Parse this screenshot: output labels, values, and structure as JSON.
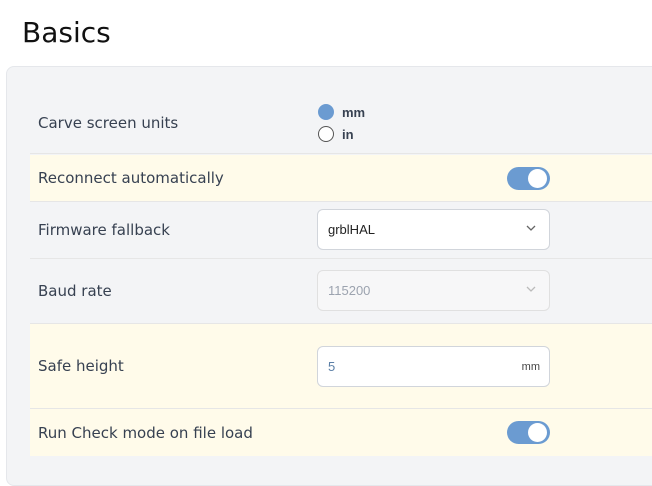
{
  "page": {
    "title": "Basics"
  },
  "settings": {
    "units": {
      "label": "Carve screen units",
      "options": [
        "mm",
        "in"
      ],
      "selected": "mm"
    },
    "reconnect": {
      "label": "Reconnect automatically",
      "enabled": true
    },
    "firmware": {
      "label": "Firmware fallback",
      "value": "grblHAL"
    },
    "baud": {
      "label": "Baud rate",
      "value": "115200",
      "disabled": true
    },
    "safe_height": {
      "label": "Safe height",
      "value": "5",
      "unit": "mm"
    },
    "check_mode": {
      "label": "Run Check mode on file load",
      "enabled": true
    }
  },
  "colors": {
    "accent": "#6b9bd1",
    "highlight": "#fffbea",
    "panel": "#f3f4f6"
  }
}
